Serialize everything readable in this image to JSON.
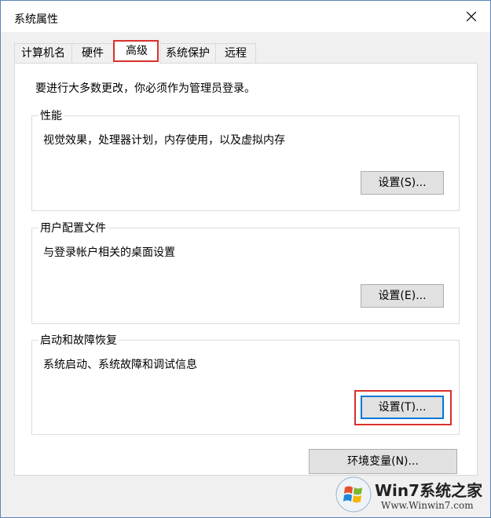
{
  "window": {
    "title": "系统属性",
    "accent": "#5a84b8"
  },
  "tabs": [
    {
      "label": "计算机名"
    },
    {
      "label": "硬件"
    },
    {
      "label": "高级"
    },
    {
      "label": "系统保护"
    },
    {
      "label": "远程"
    }
  ],
  "active_tab": "高级",
  "panel": {
    "admin_note": "要进行大多数更改，你必须作为管理员登录。",
    "performance": {
      "title": "性能",
      "description": "视觉效果，处理器计划，内存使用，以及虚拟内存",
      "button": "设置(S)..."
    },
    "user_profiles": {
      "title": "用户配置文件",
      "description": "与登录帐户相关的桌面设置",
      "button": "设置(E)..."
    },
    "startup_recovery": {
      "title": "启动和故障恢复",
      "description": "系统启动、系统故障和调试信息",
      "button": "设置(T)..."
    },
    "env_button": "环境变量(N)..."
  },
  "highlight_color": "#d9302c",
  "watermark": {
    "brand": "Win7系统之家",
    "url": "Www.Winwin7.com"
  }
}
